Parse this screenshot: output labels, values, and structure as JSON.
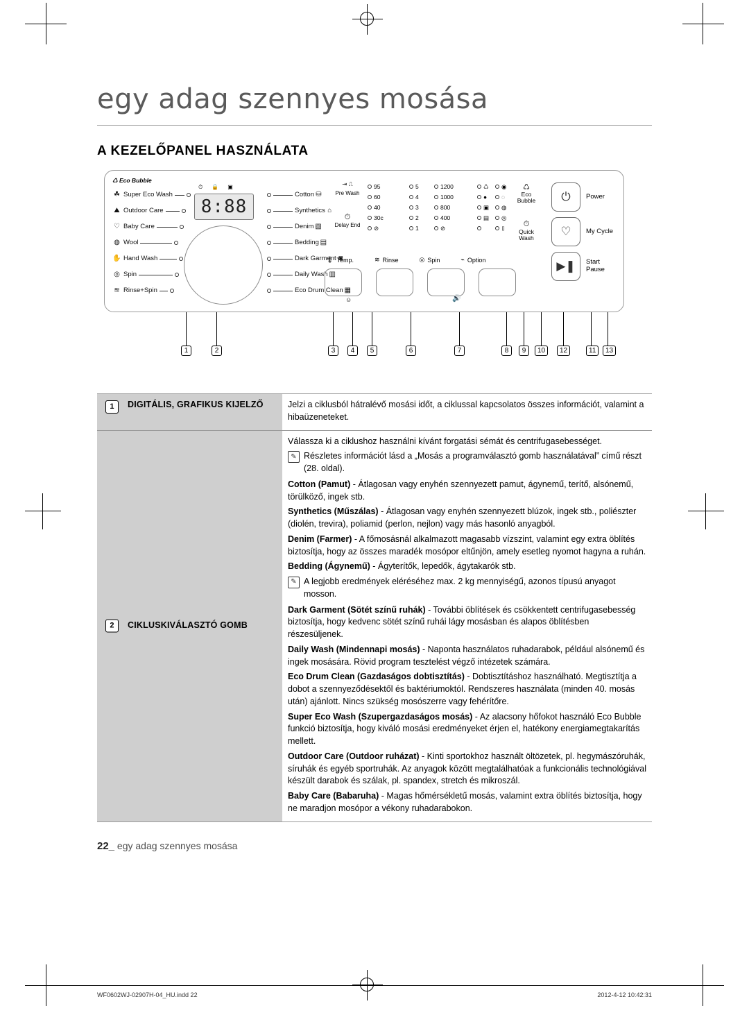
{
  "page": {
    "title": "egy adag szennyes mosása",
    "section_heading": "A KEZELŐPANEL HASZNÁLATA",
    "footer_page_number": "22_",
    "footer_text": "egy adag szennyes mosása",
    "doc_filename": "WF0602WJ-02907H-04_HU.indd   22",
    "doc_timestamp": "2012-4-12   10:42:31"
  },
  "panel": {
    "eco_bubble_tag": "Eco Bubble",
    "display_value": "8:88",
    "left_cycles": [
      {
        "icon": "☘",
        "label": "Super Eco Wash"
      },
      {
        "icon": "⛰",
        "label": "Outdoor Care"
      },
      {
        "icon": "♡",
        "label": "Baby Care"
      },
      {
        "icon": "◍",
        "label": "Wool"
      },
      {
        "icon": "✋",
        "label": "Hand Wash"
      },
      {
        "icon": "◎",
        "label": "Spin"
      },
      {
        "icon": "≋",
        "label": "Rinse+Spin"
      }
    ],
    "right_cycles": [
      {
        "label": "Cotton",
        "icon": "⛁"
      },
      {
        "label": "Synthetics",
        "icon": "⌂"
      },
      {
        "label": "Denim",
        "icon": "▧"
      },
      {
        "label": "Bedding",
        "icon": "▤"
      },
      {
        "label": "Dark Garment",
        "icon": "◙"
      },
      {
        "label": "Daily Wash",
        "icon": "▥"
      },
      {
        "label": "Eco Drum Clean",
        "icon": "▦"
      }
    ],
    "prewash_label": "Pre Wash",
    "delay_end_label": "Delay End",
    "temperature_options": [
      "95",
      "60",
      "40",
      "30c",
      "⊘"
    ],
    "rinse_options": [
      "5",
      "4",
      "3",
      "2",
      "1"
    ],
    "spin_options": [
      "1200",
      "1000",
      "800",
      "400",
      "⊘"
    ],
    "controls_row_labels": [
      "Temp.",
      "Rinse",
      "Spin",
      "Option"
    ],
    "right_buttons": [
      {
        "icon": "⏻",
        "label": "Power"
      },
      {
        "icon": "♡",
        "label": "My Cycle"
      },
      {
        "icon": "▶❚",
        "label": "Start\nPause"
      }
    ],
    "eco_bubble_button": "Eco\nBubble",
    "quick_wash_button": "Quick\nWash",
    "callout_numbers": [
      "1",
      "2",
      "3",
      "4",
      "5",
      "6",
      "7",
      "8",
      "9",
      "10",
      "12",
      "11",
      "13"
    ]
  },
  "rows": [
    {
      "number": "1",
      "label": "DIGITÁLIS, GRAFIKUS KIJELZŐ",
      "blocks": [
        {
          "type": "p",
          "html": "Jelzi a ciklusból hátralévő mosási időt, a ciklussal kapcsolatos összes információt, valamint a hibaüzeneteket."
        }
      ]
    },
    {
      "number": "2",
      "label": "CIKLUSKIVÁLASZTÓ GOMB",
      "blocks": [
        {
          "type": "p",
          "html": "Válassza ki a ciklushoz használni kívánt forgatási sémát és centrifugasebességet."
        },
        {
          "type": "note",
          "html": "Részletes információt lásd a „Mosás a programválasztó gomb használatával” című részt (28. oldal)."
        },
        {
          "type": "p",
          "html": "<b>Cotton (Pamut)</b> - Átlagosan vagy enyhén szennyezett pamut, ágynemű, terítő, alsónemű, törülköző, ingek stb."
        },
        {
          "type": "p",
          "html": "<b>Synthetics (Műszálas)</b> - Átlagosan vagy enyhén szennyezett blúzok, ingek stb., poliészter (diolén, trevira), poliamid (perlon, nejlon) vagy más hasonló anyagból."
        },
        {
          "type": "p",
          "html": "<b>Denim (Farmer)</b> - A főmosásnál alkalmazott magasabb vízszint, valamint egy extra öblítés biztosítja, hogy az összes maradék mosópor eltűnjön, amely esetleg nyomot hagyna a ruhán."
        },
        {
          "type": "p",
          "html": "<b>Bedding (Ágynemű)</b> - Ágyterítők, lepedők, ágytakarók stb."
        },
        {
          "type": "note",
          "html": "A legjobb eredmények eléréséhez max. 2 kg mennyiségű, azonos típusú anyagot mosson."
        },
        {
          "type": "p",
          "html": "<b>Dark Garment (Sötét színű ruhák)</b> -  További öblítések és csökkentett centrifugasebesség biztosítja, hogy kedvenc sötét színű ruhái lágy mosásban és alapos öblítésben részesüljenek."
        },
        {
          "type": "p",
          "html": "<b>Daily Wash (Mindennapi mosás)</b> - Naponta használatos ruhadarabok, például alsónemű és ingek mosására. Rövid program tesztelést végző intézetek számára."
        },
        {
          "type": "p",
          "html": "<b>Eco Drum Clean (Gazdaságos dobtisztítás)</b> - Dobtisztításhoz használható. Megtisztítja a dobot a szennyeződésektől és baktériumoktól. Rendszeres használata (minden 40. mosás után) ajánlott. Nincs szükség mosószerre vagy fehérítőre."
        },
        {
          "type": "p",
          "html": "<b>Super Eco Wash (Szupergazdaságos mosás)</b> - Az alacsony hőfokot használó Eco Bubble funkció biztosítja, hogy kiváló mosási eredményeket érjen el, hatékony energiamegtakarítás mellett."
        },
        {
          "type": "p",
          "html": "<b>Outdoor Care (Outdoor ruházat)</b> - Kinti sportokhoz használt öltözetek, pl. hegymászóruhák, síruhák és egyéb sportruhák. Az anyagok között megtalálhatóak a funkcionális technológiával készült darabok és szálak, pl. spandex, stretch és mikroszál."
        },
        {
          "type": "p",
          "html": "<b>Baby Care (Babaruha)</b> - Magas hőmérsékletű mosás, valamint extra öblítés biztosítja, hogy ne maradjon mosópor a vékony ruhadarabokon."
        }
      ]
    }
  ]
}
